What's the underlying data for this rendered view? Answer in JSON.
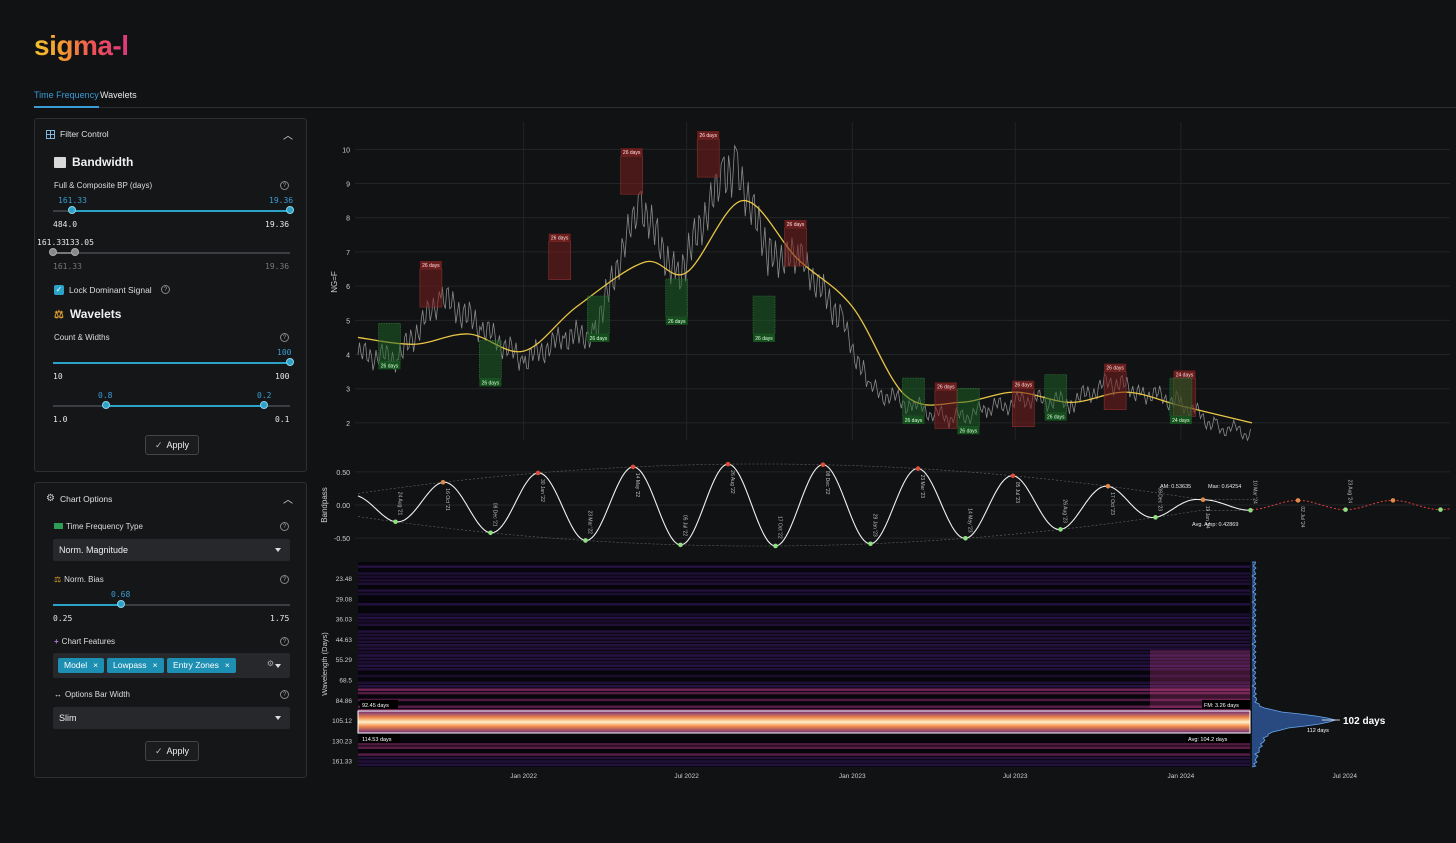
{
  "app": {
    "logo": "sigma-l",
    "tabs": [
      {
        "label": "Time Frequency",
        "active": true
      },
      {
        "label": "Wavelets",
        "active": false
      }
    ]
  },
  "filter_control": {
    "title": "Filter Control",
    "bandwidth": {
      "title": "Bandwidth",
      "label": "Full & Composite BP (days)",
      "full_range": {
        "low_value": "161.33",
        "high_value": "19.36",
        "min": "484.0",
        "max": "19.36"
      },
      "composite_range": {
        "low_value": "161.33",
        "high_value": "133.05",
        "min": "161.33",
        "max": "19.36"
      }
    },
    "lock_dominant": {
      "label": "Lock Dominant Signal",
      "checked": true
    },
    "wavelets": {
      "title": "Wavelets",
      "label": "Count & Widths",
      "count": {
        "value": "100",
        "min": "10",
        "max": "100"
      },
      "widths": {
        "low_value": "0.8",
        "high_value": "0.2",
        "min": "1.0",
        "max": "0.1"
      }
    },
    "apply_label": "Apply"
  },
  "chart_options": {
    "title": "Chart Options",
    "tf_type": {
      "label": "Time Frequency Type",
      "value": "Norm. Magnitude"
    },
    "norm_bias": {
      "label": "Norm. Bias",
      "value": "0.68",
      "min": "0.25",
      "max": "1.75"
    },
    "features": {
      "label": "Chart Features",
      "chips": [
        "Model",
        "Lowpass",
        "Entry Zones"
      ]
    },
    "bar_width": {
      "label": "Options Bar Width",
      "value": "Slim"
    },
    "apply_label": "Apply"
  },
  "colors": {
    "accent": "#2ba3c9",
    "tab_active": "#3a9bd6",
    "price": "#8a8a8a",
    "lowpass": "#e8c547",
    "peak_zone": "#b02c2c",
    "trough_zone": "#2e8b3a"
  },
  "chart_data": [
    {
      "type": "line",
      "name": "price",
      "ylabel": "NG=F",
      "yticks": [
        "10",
        "9",
        "8",
        "7",
        "6",
        "5",
        "4",
        "3",
        "2"
      ],
      "ylim": [
        1.5,
        10.8
      ],
      "x_domain": [
        "2021-07",
        "2024-09"
      ],
      "series": [
        {
          "values_x": [
            "2021-07-01",
            "2021-08-15",
            "2021-10-01",
            "2021-11-15",
            "2022-01-01",
            "2022-02-15",
            "2022-03-20",
            "2022-05-10",
            "2022-06-20",
            "2022-08-10",
            "2022-08-25",
            "2022-10-01",
            "2022-11-05",
            "2022-12-20",
            "2023-01-20",
            "2023-03-10",
            "2023-04-20",
            "2023-06-01",
            "2023-07-15",
            "2023-09-01",
            "2023-10-15",
            "2023-11-20",
            "2024-01-01",
            "2024-02-10",
            "2024-03-20"
          ],
          "values_y": [
            4.0,
            3.9,
            5.7,
            4.8,
            3.8,
            4.5,
            4.6,
            8.5,
            6.2,
            9.2,
            9.5,
            6.9,
            6.8,
            5.0,
            3.0,
            2.5,
            2.1,
            2.4,
            2.7,
            2.6,
            3.2,
            2.9,
            2.6,
            1.9,
            1.7
          ]
        },
        {
          "values_x": [
            "2021-07-01",
            "2021-09-01",
            "2021-11-01",
            "2022-01-01",
            "2022-03-01",
            "2022-05-15",
            "2022-07-01",
            "2022-09-01",
            "2022-11-01",
            "2023-01-01",
            "2023-03-01",
            "2023-05-01",
            "2023-07-01",
            "2023-09-01",
            "2023-11-01",
            "2024-01-01",
            "2024-03-20"
          ],
          "values_y": [
            4.5,
            4.3,
            4.6,
            4.1,
            5.4,
            6.7,
            6.4,
            8.5,
            6.8,
            5.4,
            2.8,
            2.6,
            2.9,
            2.6,
            2.9,
            2.5,
            2.0
          ]
        }
      ]
    },
    {
      "type": "line",
      "name": "bandpass",
      "ylabel": "Bandpass",
      "yticks": [
        "0.50",
        "0.00",
        "-0.50"
      ],
      "ylim": [
        -0.65,
        0.65
      ],
      "annotations": [
        "AM: 0.53635",
        "Max: 0.64254",
        "Avg. Amp: 0.42869"
      ],
      "date_labels": [
        "24 Aug '21",
        "16 Oct '21",
        "08 Dec '21",
        "30 Jan '22",
        "23 Mar '22",
        "14 May '22",
        "05 Jul '22",
        "26 Aug '22",
        "17 Oct '22",
        "08 Dec '22",
        "29 Jan '23",
        "23 Mar '23",
        "14 May '23",
        "05 Jul '23",
        "26 Aug '23",
        "17 Oct '23",
        "08 Dec '23",
        "19 Jan '24",
        "10 Mar '24",
        "02 Jul '24",
        "23 Aug '24"
      ]
    },
    {
      "type": "heatmap",
      "name": "spectrogram",
      "ylabel": "Wavelength (Days)",
      "yticks": [
        "23.48",
        "29.08",
        "36.03",
        "44.63",
        "55.29",
        "68.5",
        "84.86",
        "105.12",
        "130.23",
        "161.33"
      ],
      "xticks": [
        "Jan 2022",
        "Jul 2022",
        "Jan 2023",
        "Jul 2023",
        "Jan 2024",
        "Jul 2024"
      ],
      "band_labels": [
        "92.45 days",
        "114.53 days",
        "FM: 3.26 days",
        "Avg: 104.2 days"
      ],
      "dominant": "102 days",
      "secondary": "112 days"
    }
  ],
  "zones": {
    "peak_labels": [
      "26 days",
      "26 days",
      "26 days",
      "26 days",
      "26 days",
      "26 days",
      "26 days",
      "26 days",
      "24 days",
      "24 days"
    ],
    "trough_labels": [
      "26 days",
      "26 days",
      "26 days",
      "26 days",
      "26 days",
      "26 days",
      "26 days",
      "26 days",
      "24 days"
    ]
  }
}
